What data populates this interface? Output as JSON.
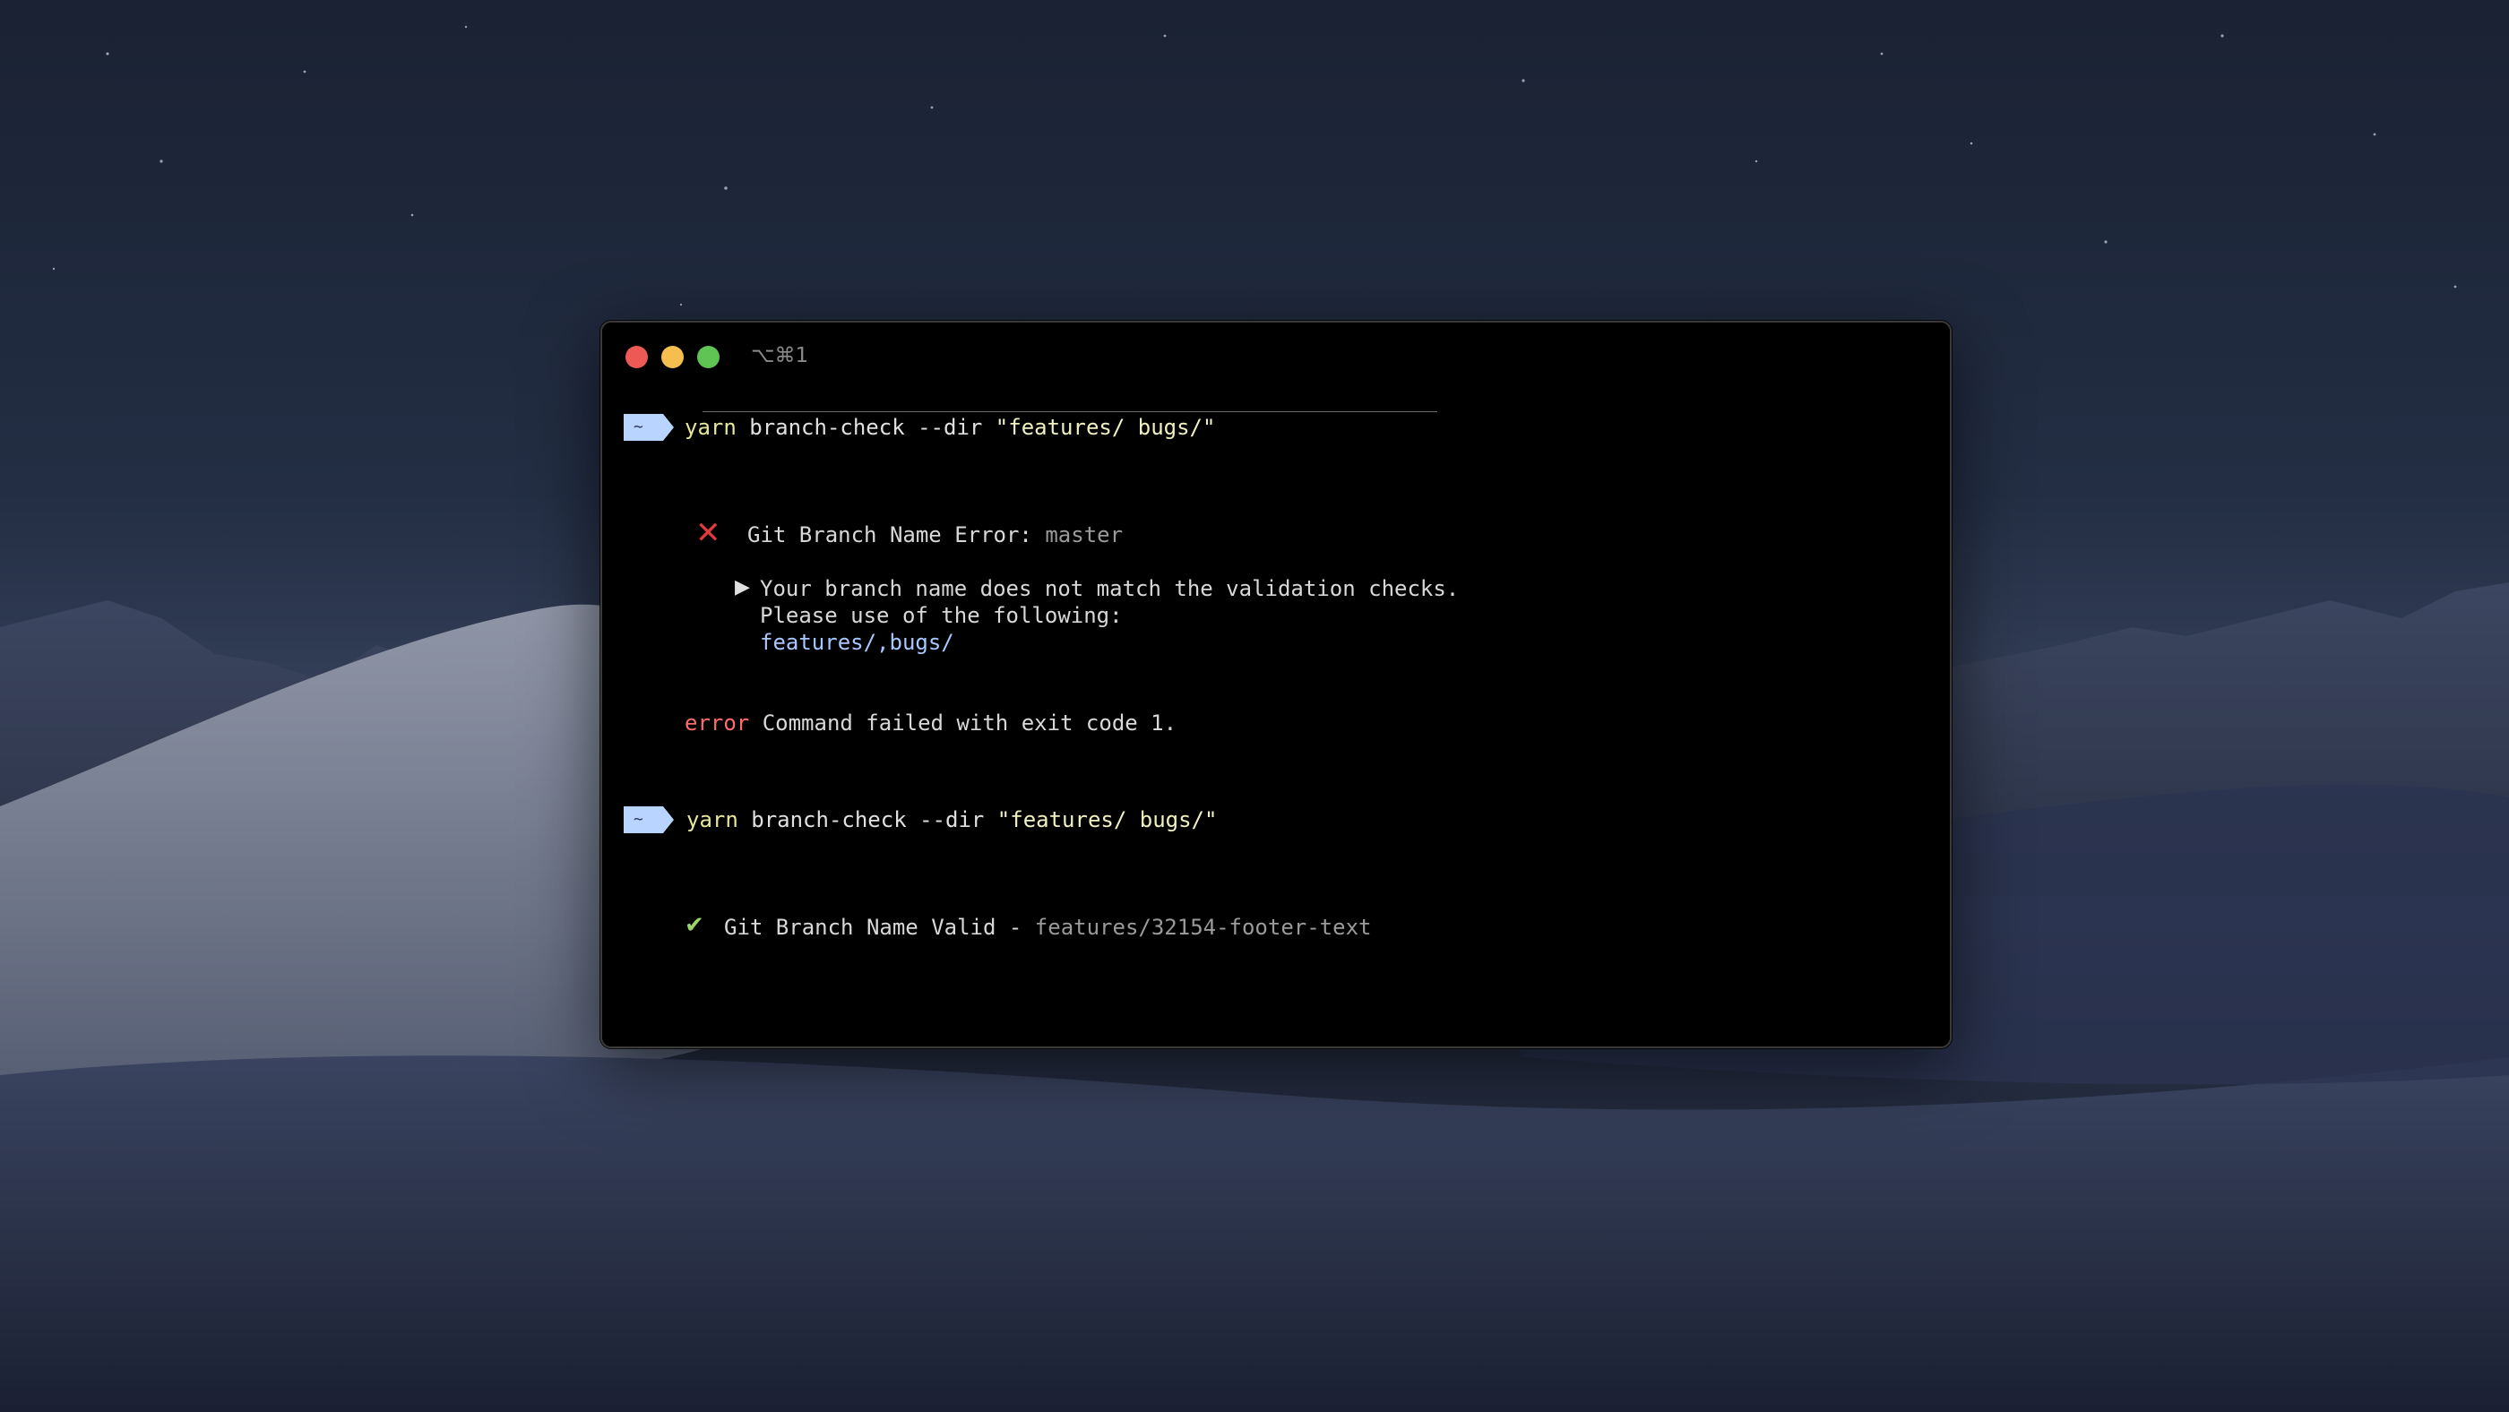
{
  "window": {
    "title": "⌥⌘1"
  },
  "prompt_symbol": "~",
  "commands": [
    {
      "program": "yarn",
      "args": "branch-check --dir",
      "arg_string": "\"features/ bugs/\""
    },
    {
      "program": "yarn",
      "args": "branch-check --dir",
      "arg_string": "\"features/ bugs/\""
    }
  ],
  "error_block": {
    "icon": "cross-mark-icon",
    "heading": "Git Branch Name Error:",
    "branch": "master",
    "bullet_icon": "triangle-right-icon",
    "message_line1": "Your branch name does not match the validation checks.",
    "message_line2": "Please use of the following:",
    "allowed": "features/,bugs/",
    "error_label": "error",
    "error_text": "Command failed with exit code 1."
  },
  "success_block": {
    "icon": "check-mark-icon",
    "heading": "Git Branch Name Valid -",
    "branch": "features/32154-footer-text"
  },
  "colors": {
    "prompt_badge": "#b9d4ff",
    "close": "#ed5a56",
    "minimize": "#f4bf4f",
    "maximize": "#5fc454",
    "error_red": "#e23a3a",
    "success_green": "#9ad46a",
    "link_blue": "#a7c8ff"
  }
}
